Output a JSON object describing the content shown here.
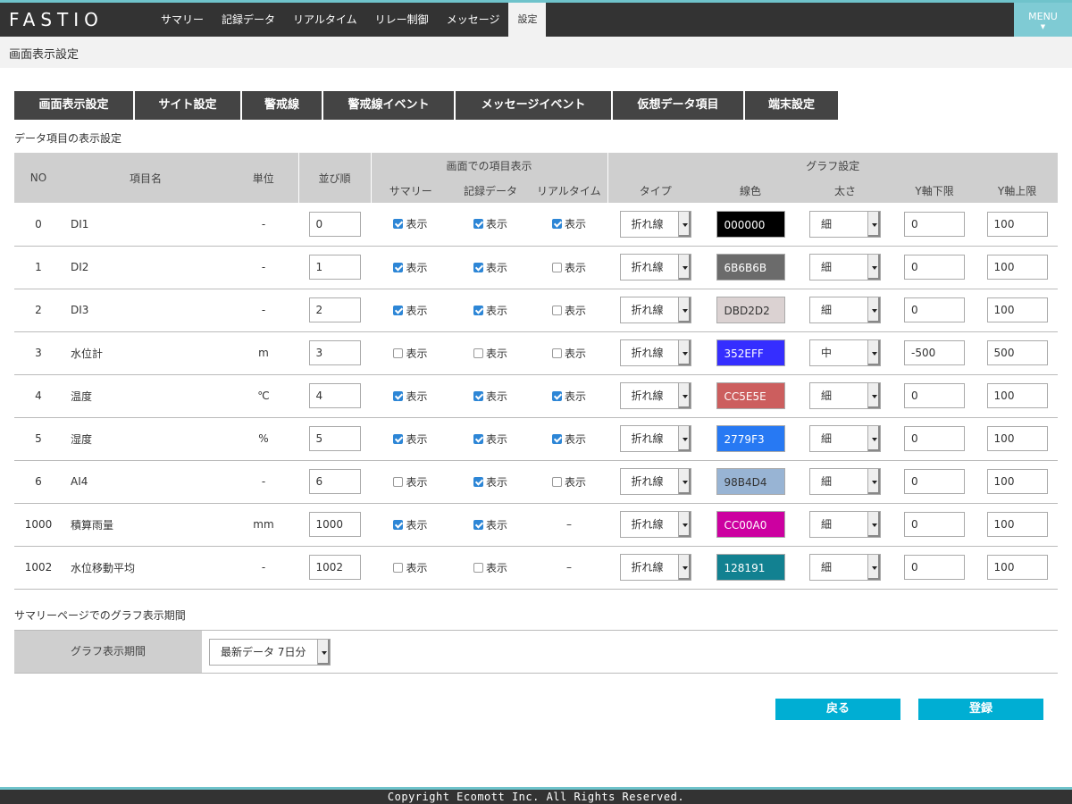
{
  "app": {
    "logo": "FASTIO",
    "menu_label": "MENU"
  },
  "nav": [
    {
      "label": "サマリー",
      "active": false
    },
    {
      "label": "記録データ",
      "active": false
    },
    {
      "label": "リアルタイム",
      "active": false
    },
    {
      "label": "リレー制御",
      "active": false
    },
    {
      "label": "メッセージ",
      "active": false
    },
    {
      "label": "設定",
      "active": true
    }
  ],
  "page_title": "画面表示設定",
  "tabs": [
    {
      "label": "画面表示設定"
    },
    {
      "label": "サイト設定"
    },
    {
      "label": "警戒線"
    },
    {
      "label": "警戒線イベント"
    },
    {
      "label": "メッセージイベント"
    },
    {
      "label": "仮想データ項目"
    },
    {
      "label": "端末設定"
    }
  ],
  "section_items_title": "データ項目の表示設定",
  "table": {
    "headers": {
      "no": "NO",
      "name": "項目名",
      "unit": "単位",
      "order": "並び順",
      "display_group": "画面での項目表示",
      "summary": "サマリー",
      "record": "記録データ",
      "realtime": "リアルタイム",
      "graph_group": "グラフ設定",
      "type": "タイプ",
      "color": "線色",
      "width": "太さ",
      "ymin": "Y軸下限",
      "ymax": "Y軸上限"
    },
    "show_label": "表示",
    "dash": "–",
    "rows": [
      {
        "no": "0",
        "name": "DI1",
        "unit": "-",
        "order": "0",
        "summary": true,
        "record": true,
        "realtime": true,
        "type": "折れ線",
        "color": "000000",
        "color_hex": "#000000",
        "color_text": "#ffffff",
        "width": "細",
        "ymin": "0",
        "ymax": "100"
      },
      {
        "no": "1",
        "name": "DI2",
        "unit": "-",
        "order": "1",
        "summary": true,
        "record": true,
        "realtime": false,
        "type": "折れ線",
        "color": "6B6B6B",
        "color_hex": "#6B6B6B",
        "color_text": "#ffffff",
        "width": "細",
        "ymin": "0",
        "ymax": "100"
      },
      {
        "no": "2",
        "name": "DI3",
        "unit": "-",
        "order": "2",
        "summary": true,
        "record": true,
        "realtime": false,
        "type": "折れ線",
        "color": "DBD2D2",
        "color_hex": "#DBD2D2",
        "color_text": "#333333",
        "width": "細",
        "ymin": "0",
        "ymax": "100"
      },
      {
        "no": "3",
        "name": "水位計",
        "unit": "m",
        "order": "3",
        "summary": false,
        "record": false,
        "realtime": false,
        "type": "折れ線",
        "color": "352EFF",
        "color_hex": "#352EFF",
        "color_text": "#ffffff",
        "width": "中",
        "ymin": "-500",
        "ymax": "500"
      },
      {
        "no": "4",
        "name": "温度",
        "unit": "℃",
        "order": "4",
        "summary": true,
        "record": true,
        "realtime": true,
        "type": "折れ線",
        "color": "CC5E5E",
        "color_hex": "#CC5E5E",
        "color_text": "#ffffff",
        "width": "細",
        "ymin": "0",
        "ymax": "100"
      },
      {
        "no": "5",
        "name": "湿度",
        "unit": "%",
        "order": "5",
        "summary": true,
        "record": true,
        "realtime": true,
        "type": "折れ線",
        "color": "2779F3",
        "color_hex": "#2779F3",
        "color_text": "#ffffff",
        "width": "細",
        "ymin": "0",
        "ymax": "100"
      },
      {
        "no": "6",
        "name": "AI4",
        "unit": "-",
        "order": "6",
        "summary": false,
        "record": true,
        "realtime": false,
        "type": "折れ線",
        "color": "98B4D4",
        "color_hex": "#98B4D4",
        "color_text": "#333333",
        "width": "細",
        "ymin": "0",
        "ymax": "100"
      },
      {
        "no": "1000",
        "name": "積算雨量",
        "unit": "mm",
        "order": "1000",
        "summary": true,
        "record": true,
        "realtime": null,
        "type": "折れ線",
        "color": "CC00A0",
        "color_hex": "#CC00A0",
        "color_text": "#ffffff",
        "width": "細",
        "ymin": "0",
        "ymax": "100"
      },
      {
        "no": "1002",
        "name": "水位移動平均",
        "unit": "-",
        "order": "1002",
        "summary": false,
        "record": false,
        "realtime": null,
        "type": "折れ線",
        "color": "128191",
        "color_hex": "#128191",
        "color_text": "#ffffff",
        "width": "細",
        "ymin": "0",
        "ymax": "100"
      }
    ]
  },
  "section_period_title": "サマリーページでのグラフ表示期間",
  "period": {
    "label": "グラフ表示期間",
    "value": "最新データ 7日分"
  },
  "buttons": {
    "back": "戻る",
    "register": "登録"
  },
  "footer": "Copyright Ecomott Inc. All Rights Reserved."
}
